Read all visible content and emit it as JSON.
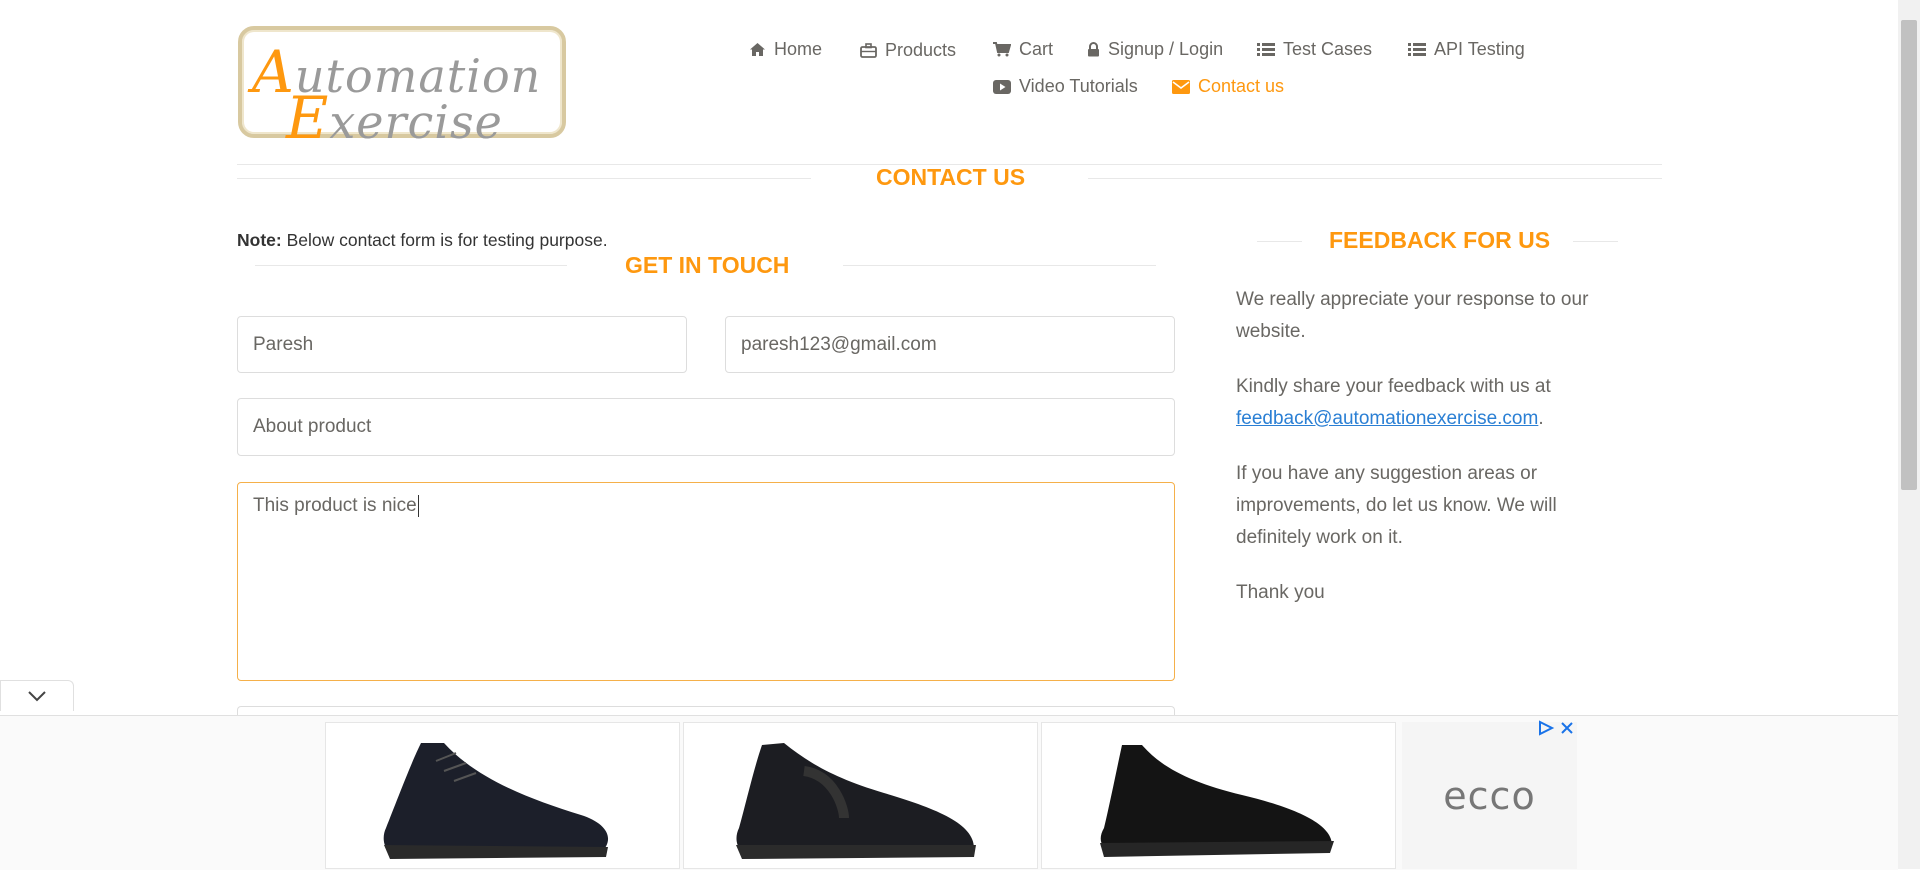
{
  "logo": {
    "line1_cap": "A",
    "line1_rest": "utomation",
    "line2_cap": "E",
    "line2_rest": "xercise"
  },
  "nav": {
    "home": "Home",
    "products": "Products",
    "cart": "Cart",
    "signup": "Signup / Login",
    "testcases": "Test Cases",
    "api": "API Testing",
    "videos": "Video Tutorials",
    "contact": "Contact us"
  },
  "page_title": "CONTACT US",
  "note": {
    "bold": "Note:",
    "text": " Below contact form is for testing purpose."
  },
  "get_in_touch": "GET IN TOUCH",
  "form": {
    "name": "Paresh",
    "email": "paresh123@gmail.com",
    "subject": "About product",
    "message": "This product is nice"
  },
  "feedback": {
    "title": "FEEDBACK FOR US",
    "p1": "We really appreciate your response to our website.",
    "p2_text": "Kindly share your feedback with us at ",
    "p2_link": "feedback@automationexercise.com",
    "p2_end": ".",
    "p3": "If you have any suggestion areas or improvements, do let us know. We will definitely work on it.",
    "p4": "Thank you"
  },
  "ad": {
    "brand": "ecco"
  },
  "colors": {
    "accent": "#fe980f",
    "text": "#696763",
    "link": "#2a7fd4"
  },
  "icons": [
    "home-icon",
    "briefcase-icon",
    "cart-icon",
    "lock-icon",
    "list-icon",
    "youtube-icon",
    "envelope-icon",
    "chevron-down-icon",
    "adchoices-icon",
    "close-icon"
  ]
}
